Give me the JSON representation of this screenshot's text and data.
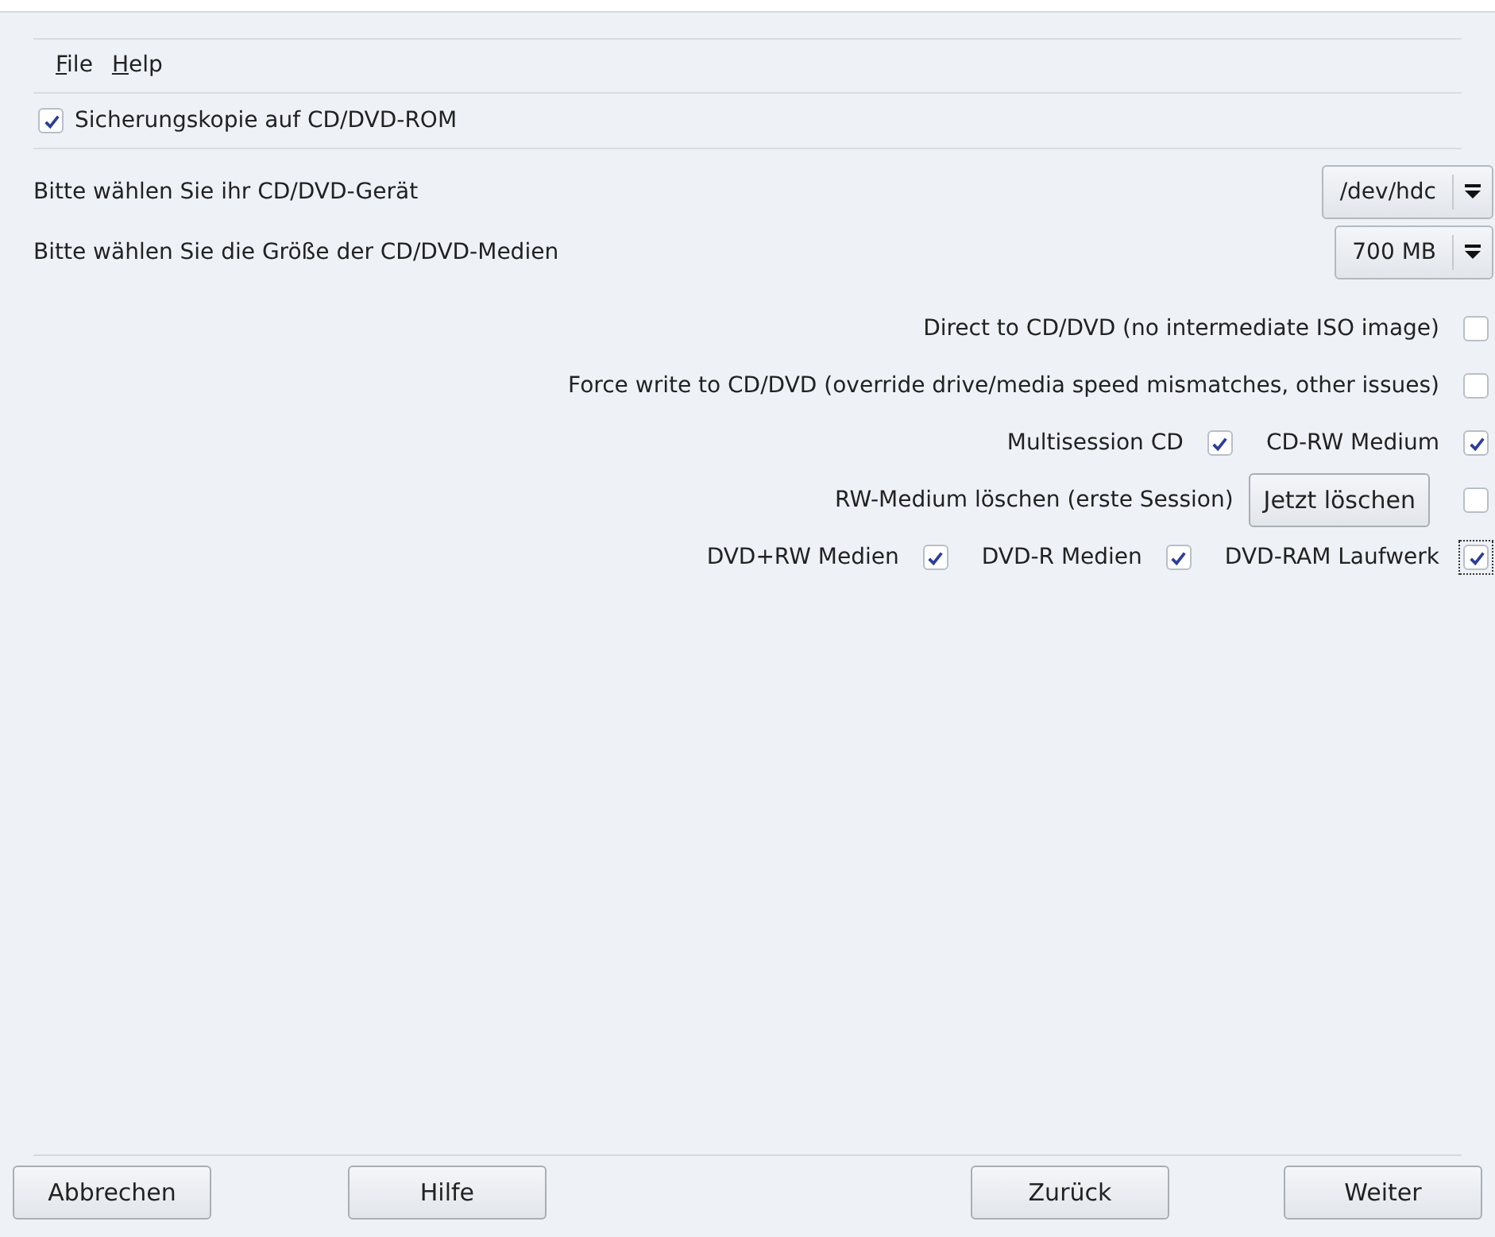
{
  "menu": [
    {
      "label": "File"
    },
    {
      "label": "Help"
    }
  ],
  "backup": {
    "label": "Sicherungskopie auf CD/DVD-ROM",
    "checked": true
  },
  "selects": [
    {
      "label": "Bitte wählen Sie ihr CD/DVD-Gerät",
      "value": "/dev/hdc"
    },
    {
      "label": "Bitte wählen Sie die Größe der CD/DVD-Medien",
      "value": "700 MB"
    }
  ],
  "option_rows": [
    {
      "items": [
        {
          "kind": "checkbox",
          "label": "Direct to CD/DVD (no intermediate ISO image)",
          "checked": false,
          "focused": false
        }
      ]
    },
    {
      "items": [
        {
          "kind": "checkbox",
          "label": "Force write to CD/DVD (override drive/media speed mismatches, other issues)",
          "checked": false,
          "focused": false
        }
      ]
    },
    {
      "items": [
        {
          "kind": "checkbox",
          "label": "Multisession CD",
          "checked": true,
          "focused": false
        },
        {
          "kind": "checkbox",
          "label": "CD-RW Medium",
          "checked": true,
          "focused": false
        }
      ]
    },
    {
      "items": [
        {
          "kind": "text",
          "label": "RW-Medium löschen (erste Session)"
        },
        {
          "kind": "button",
          "label": "Jetzt löschen"
        },
        {
          "kind": "checkbox",
          "checked": false,
          "focused": false
        }
      ]
    },
    {
      "items": [
        {
          "kind": "checkbox",
          "label": "DVD+RW Medien",
          "checked": true,
          "focused": false
        },
        {
          "kind": "checkbox",
          "label": "DVD-R Medien",
          "checked": true,
          "focused": false
        },
        {
          "kind": "checkbox",
          "label": "DVD-RAM Laufwerk",
          "checked": true,
          "focused": true
        }
      ]
    }
  ],
  "buttons": [
    {
      "label": "Abbrechen"
    },
    {
      "label": "Hilfe"
    },
    {
      "label": "Zurück"
    },
    {
      "label": "Weiter"
    }
  ]
}
